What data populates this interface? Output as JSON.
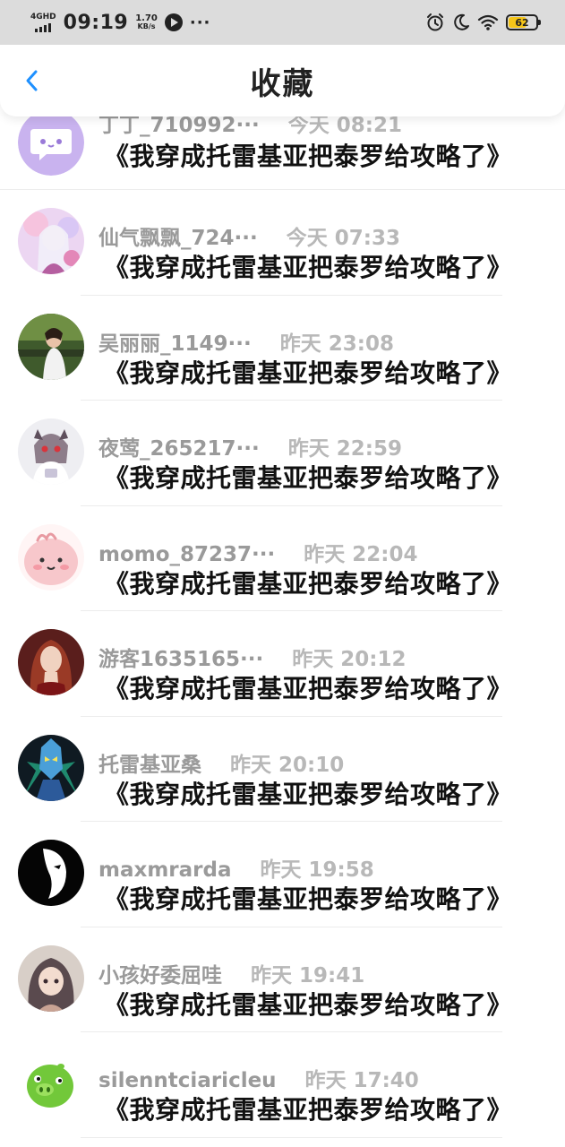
{
  "status_bar": {
    "network": "4GHD",
    "time": "09:19",
    "speed_value": "1.70",
    "speed_unit": "KB/s",
    "more": "···",
    "battery_level": "62",
    "icons": [
      "signal-icon",
      "play-icon",
      "alarm-icon",
      "moon-icon",
      "wifi-icon",
      "battery-icon"
    ]
  },
  "header": {
    "title": "收藏",
    "back_icon": "chevron-left-icon",
    "accent_color": "#1e90ff"
  },
  "items": [
    {
      "username": "丁丁_710992···",
      "time": "今天 08:21",
      "novel": "《我穿成托雷基亚把泰罗给攻略了》",
      "avatar": "purple-chat-avatar"
    },
    {
      "username": "仙气飘飘_724···",
      "time": "今天 07:33",
      "novel": "《我穿成托雷基亚把泰罗给攻略了》",
      "avatar": "anime-girl-pink-avatar"
    },
    {
      "username": "吴丽丽_1149···",
      "time": "昨天 23:08",
      "novel": "《我穿成托雷基亚把泰罗给攻略了》",
      "avatar": "photo-woman-avatar"
    },
    {
      "username": "夜莺_265217···",
      "time": "昨天 22:59",
      "novel": "《我穿成托雷基亚把泰罗给攻略了》",
      "avatar": "chibi-character-avatar"
    },
    {
      "username": "momo_87237···",
      "time": "昨天 22:04",
      "novel": "《我穿成托雷基亚把泰罗给攻略了》",
      "avatar": "pink-blob-avatar"
    },
    {
      "username": "游客1635165···",
      "time": "昨天 20:12",
      "novel": "《我穿成托雷基亚把泰罗给攻略了》",
      "avatar": "red-hair-woman-avatar"
    },
    {
      "username": "托雷基亚桑",
      "time": "昨天 20:10",
      "novel": "《我穿成托雷基亚把泰罗给攻略了》",
      "avatar": "ultraman-avatar"
    },
    {
      "username": "maxmrarda",
      "time": "昨天 19:58",
      "novel": "《我穿成托雷基亚把泰罗给攻略了》",
      "avatar": "mask-face-avatar"
    },
    {
      "username": "小孩好委屈哇",
      "time": "昨天 19:41",
      "novel": "《我穿成托雷基亚把泰罗给攻略了》",
      "avatar": "anime-girl-dark-avatar"
    },
    {
      "username": "silenntciaricleu",
      "time": "昨天 17:40",
      "novel": "《我穿成托雷基亚把泰罗给攻略了》",
      "avatar": "green-pig-avatar"
    }
  ]
}
